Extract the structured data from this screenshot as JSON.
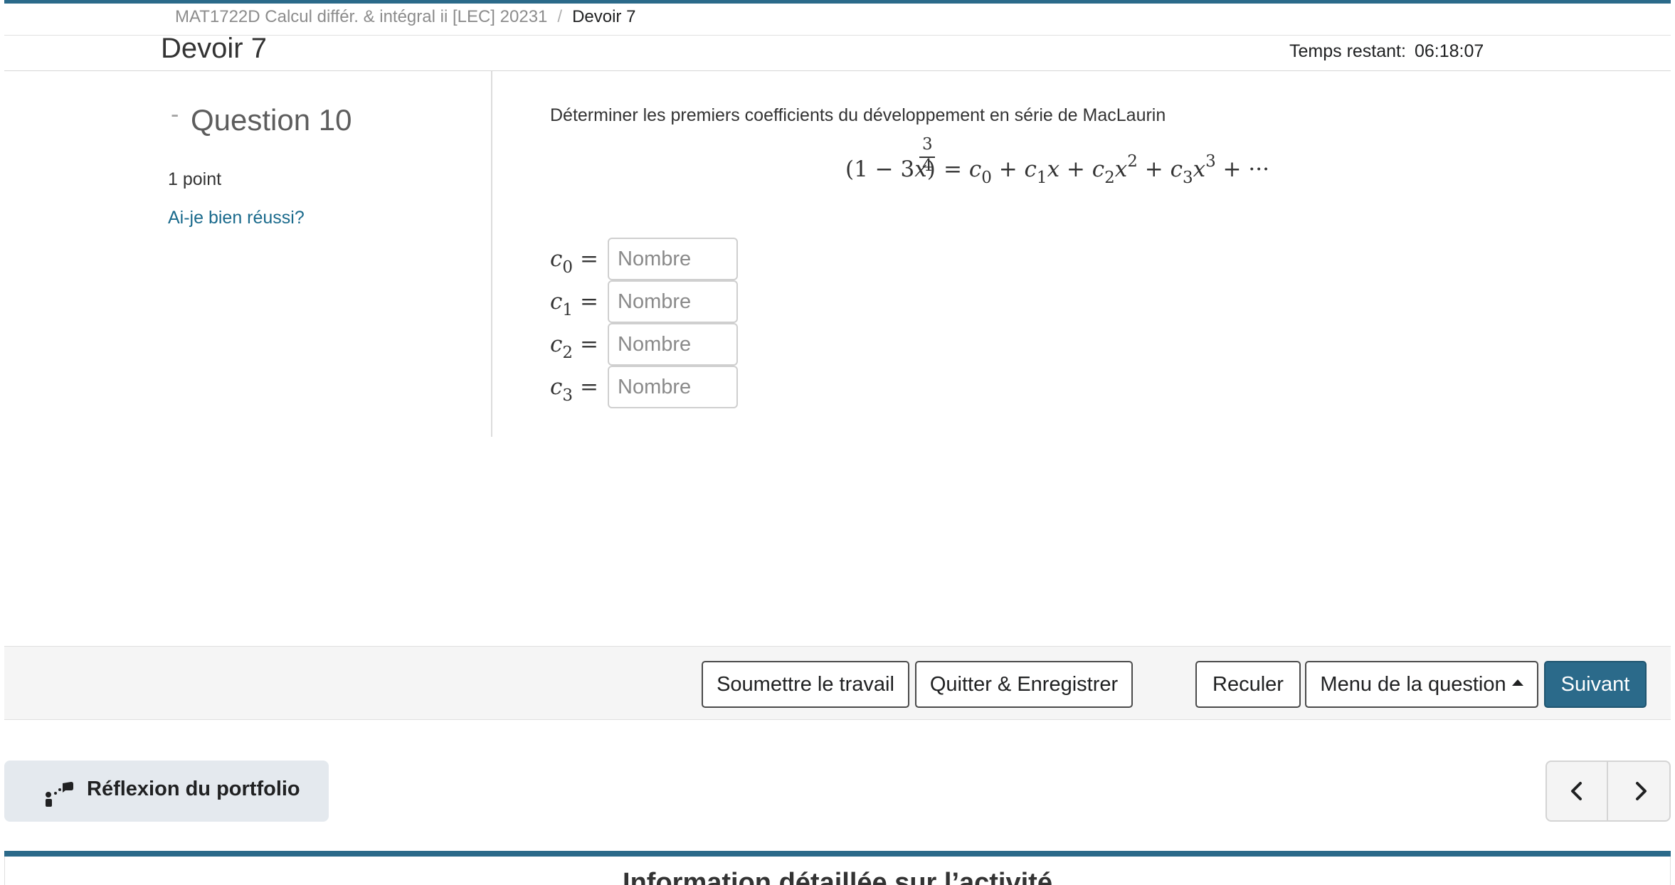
{
  "breadcrumb": {
    "course": "MAT1722D Calcul différ. & intégral ii [LEC] 20231",
    "separator": "/",
    "current": "Devoir 7"
  },
  "header": {
    "title": "Devoir 7",
    "timer_label": "Temps restant:",
    "timer_value": "06:18:07"
  },
  "question": {
    "title": "Question 10",
    "points": "1 point",
    "check_link": "Ai-je bien réussi?",
    "prompt": "Déterminer les premiers coefficients du développement en série de MacLaurin",
    "formula": {
      "base": "(1 − 3",
      "var": "x",
      "close": ")",
      "exp_num": "3",
      "exp_den": "4",
      "rhs": "= c0 + c1x + c2x2 + c3x3 + ···"
    }
  },
  "answers": [
    {
      "label": "c",
      "sub": "0",
      "eq": "=",
      "placeholder": "Nombre"
    },
    {
      "label": "c",
      "sub": "1",
      "eq": "=",
      "placeholder": "Nombre"
    },
    {
      "label": "c",
      "sub": "2",
      "eq": "=",
      "placeholder": "Nombre"
    },
    {
      "label": "c",
      "sub": "3",
      "eq": "=",
      "placeholder": "Nombre"
    }
  ],
  "actions": {
    "submit": "Soumettre le travail",
    "save_quit": "Quitter & Enregistrer",
    "back": "Reculer",
    "menu": "Menu de la question",
    "next": "Suivant"
  },
  "portfolio": {
    "label": "Réflexion du portfolio",
    "icon": "portfolio-reflection-icon"
  },
  "pager": {
    "prev_icon": "chevron-left-icon",
    "next_icon": "chevron-right-icon"
  },
  "bottom": {
    "title": "Information détaillée sur l’activité"
  },
  "colors": {
    "accent": "#2b6a8a",
    "link": "#1a6a8c"
  }
}
